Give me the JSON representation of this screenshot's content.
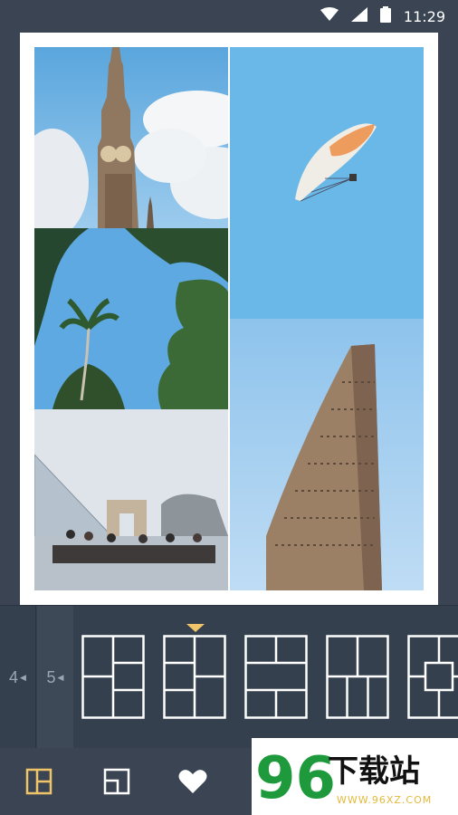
{
  "status": {
    "time": "11:29"
  },
  "layout_picker": {
    "counts": [
      "4",
      "5"
    ],
    "selected_count": "5",
    "selected_layout_index": 1
  },
  "toolbar": {
    "tools": [
      "layout-icon",
      "frame-icon",
      "favorite-icon"
    ]
  },
  "watermark": {
    "logo_text": "96下载站",
    "site": "WWW.96XZ.COM"
  },
  "colors": {
    "background": "#3a4453",
    "accent": "#f0c56a",
    "sky": "#6ab8e8"
  }
}
